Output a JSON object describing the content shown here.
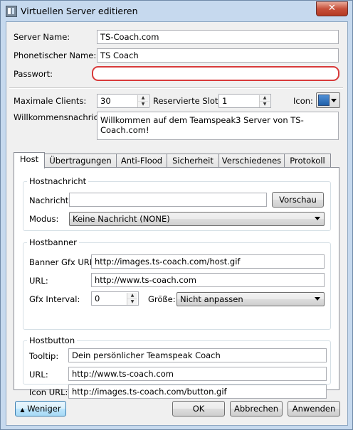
{
  "window": {
    "title": "Virtuellen Server editieren",
    "close_glyph": "✕"
  },
  "fields": {
    "server_name_label": "Server Name:",
    "server_name_value": "TS-Coach.com",
    "phonetic_label": "Phonetischer Name:",
    "phonetic_value": "TS Coach",
    "password_label": "Passwort:",
    "password_value": "",
    "max_clients_label": "Maximale Clients:",
    "max_clients_value": "30",
    "reserved_label": "Reservierte Slots:",
    "reserved_value": "1",
    "icon_label": "Icon:",
    "welcome_label": "Willkommensnachricht:",
    "welcome_value": "Willkommen auf dem Teamspeak3 Server von TS-Coach.com!"
  },
  "tabs": [
    "Host",
    "Übertragungen",
    "Anti-Flood",
    "Sicherheit",
    "Verschiedenes",
    "Protokoll"
  ],
  "hostmessage": {
    "group_title": "Hostnachricht",
    "message_label": "Nachricht:",
    "message_value": "",
    "preview_button": "Vorschau",
    "mode_label": "Modus:",
    "mode_value": "Keine Nachricht (NONE)"
  },
  "hostbanner": {
    "group_title": "Hostbanner",
    "gfx_url_label": "Banner Gfx URL:",
    "gfx_url_value": "http://images.ts-coach.com/host.gif",
    "url_label": "URL:",
    "url_value": "http://www.ts-coach.com",
    "interval_label": "Gfx Interval:",
    "interval_value": "0",
    "size_label": "Größe:",
    "size_value": "Nicht anpassen"
  },
  "hostbutton": {
    "group_title": "Hostbutton",
    "tooltip_label": "Tooltip:",
    "tooltip_value": "Dein persönlicher Teamspeak Coach",
    "url_label": "URL:",
    "url_value": "http://www.ts-coach.com",
    "icon_url_label": "Icon URL:",
    "icon_url_value": "http://images.ts-coach.com/button.gif"
  },
  "footer": {
    "less_button": "Weniger",
    "less_glyph": "▲",
    "ok_button": "OK",
    "cancel_button": "Abbrechen",
    "apply_button": "Anwenden"
  },
  "colors": {
    "error_border": "#d83a3a",
    "window_frame": "#c6d9ee",
    "close_button": "#c7503a"
  }
}
